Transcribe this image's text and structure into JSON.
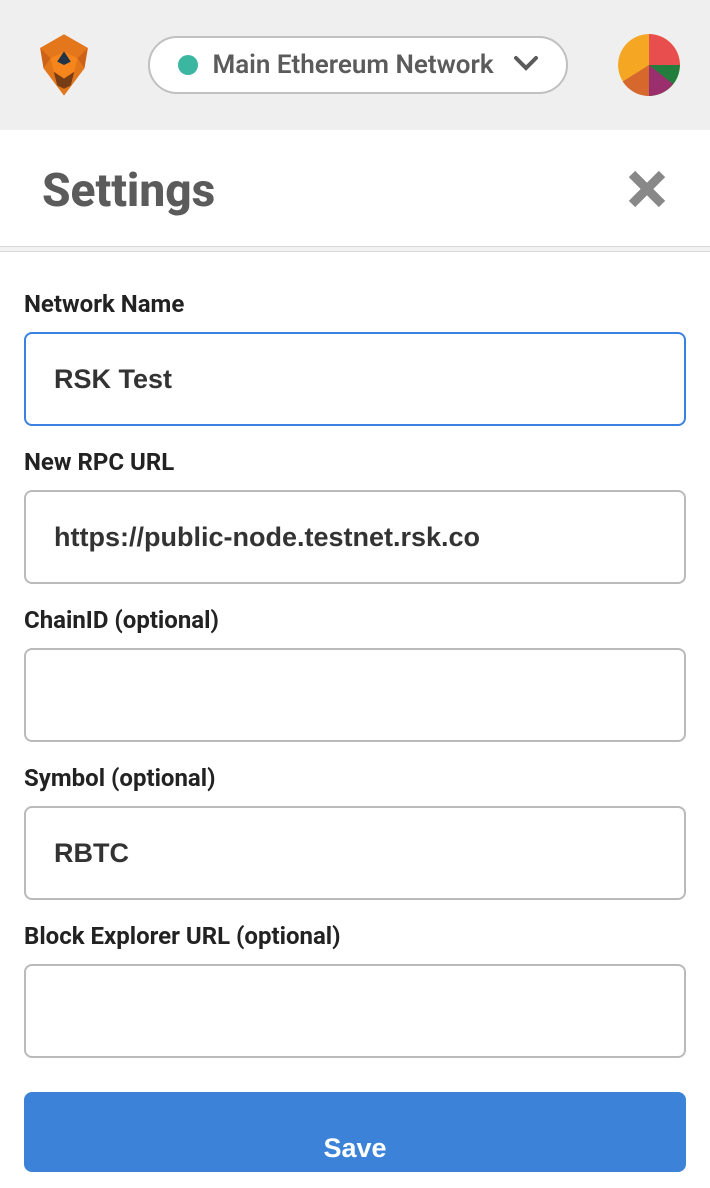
{
  "header": {
    "network_label": "Main Ethereum Network"
  },
  "page": {
    "title": "Settings"
  },
  "form": {
    "network_name": {
      "label": "Network Name",
      "value": "RSK Test"
    },
    "rpc_url": {
      "label": "New RPC URL",
      "value": "https://public-node.testnet.rsk.co"
    },
    "chain_id": {
      "label": "ChainID (optional)",
      "value": ""
    },
    "symbol": {
      "label": "Symbol (optional)",
      "value": "RBTC"
    },
    "block_explorer": {
      "label": "Block Explorer URL (optional)",
      "value": ""
    },
    "save_label": "Save"
  }
}
